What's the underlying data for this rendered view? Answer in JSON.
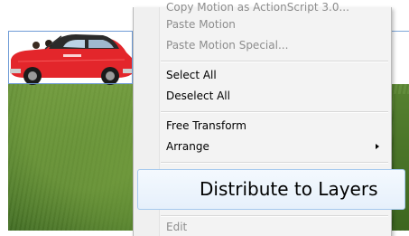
{
  "context_menu": {
    "items": [
      {
        "label": "Paste Motion",
        "enabled": false
      },
      {
        "label": "Paste Motion Special...",
        "enabled": false
      },
      {
        "label": "Select All",
        "enabled": true
      },
      {
        "label": "Deselect All",
        "enabled": true
      },
      {
        "label": "Free Transform",
        "enabled": true
      },
      {
        "label": "Arrange",
        "enabled": true,
        "has_submenu": true
      },
      {
        "label": "Distribute to Layers",
        "enabled": true,
        "highlighted": true
      },
      {
        "label": "Edit",
        "enabled": false
      }
    ]
  },
  "stage": {
    "artwork": "red-car-on-grass-icon"
  },
  "colors": {
    "menu_background": "#f3f3f3",
    "highlight_border": "#a6c9ee",
    "disabled_text": "#8d8d8d",
    "selection_outline": "#6f9bd6",
    "car_body": "#e3262b"
  }
}
